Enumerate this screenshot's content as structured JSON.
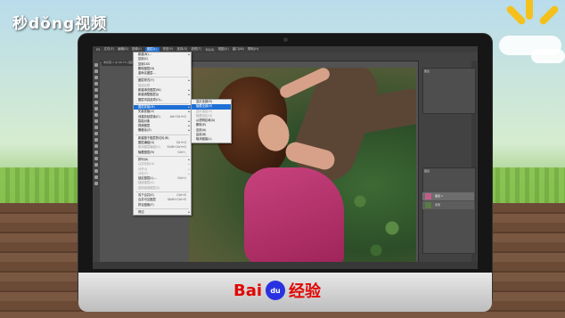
{
  "watermark_top": "秒dǒng视频",
  "brand": {
    "left": "Bai",
    "paw": "du",
    "right": "经验"
  },
  "menubar": [
    "PS",
    "文件(F)",
    "编辑(E)",
    "图像(I)",
    "图层(L)",
    "类型(Y)",
    "选择(S)",
    "滤镜(T)",
    "3D(D)",
    "视图(V)",
    "窗口(W)",
    "帮助(H)"
  ],
  "doc_tab": "未标题-1 @ 66.7% (图层 1, RGB/8)",
  "main_menu": {
    "items": [
      {
        "label": "新建(N)...",
        "shortcut": "",
        "disabled": false,
        "arrow": true
      },
      {
        "label": "复制(C)",
        "shortcut": "",
        "disabled": false
      },
      {
        "label": "复制CSS",
        "shortcut": "",
        "disabled": false
      },
      {
        "label": "删除图层(D)",
        "shortcut": "",
        "disabled": false
      },
      {
        "label": "重命名图层...",
        "shortcut": "",
        "disabled": false
      },
      {
        "label": "图层样式(Y)",
        "shortcut": "",
        "disabled": false,
        "arrow": true
      },
      {
        "label": "智能滤镜",
        "shortcut": "",
        "disabled": true
      },
      {
        "label": "新建填充图层(W)",
        "shortcut": "",
        "disabled": false,
        "arrow": true
      },
      {
        "label": "新建调整图层(J)",
        "shortcut": "",
        "disabled": false,
        "arrow": true
      },
      {
        "label": "图层内容选项(O)...",
        "shortcut": "",
        "disabled": false
      },
      {
        "label": "图层蒙版(M)",
        "shortcut": "",
        "disabled": false,
        "arrow": true,
        "highlight": true
      },
      {
        "label": "矢量蒙版(V)",
        "shortcut": "",
        "disabled": false,
        "arrow": true
      },
      {
        "label": "创建剪贴蒙版(C)",
        "shortcut": "Alt+Ctrl+G",
        "disabled": false
      },
      {
        "label": "智能对象",
        "shortcut": "",
        "disabled": false,
        "arrow": true
      },
      {
        "label": "视频图层",
        "shortcut": "",
        "disabled": false,
        "arrow": true
      },
      {
        "label": "栅格化(Z)",
        "shortcut": "",
        "disabled": false,
        "arrow": true
      },
      {
        "label": "新建基于图层的切片(B)",
        "shortcut": "",
        "disabled": false
      },
      {
        "label": "图层编组(G)",
        "shortcut": "Ctrl+G",
        "disabled": false
      },
      {
        "label": "取消图层编组(U)",
        "shortcut": "Shift+Ctrl+G",
        "disabled": true
      },
      {
        "label": "隐藏图层(R)",
        "shortcut": "Ctrl+,",
        "disabled": false
      },
      {
        "label": "排列(A)",
        "shortcut": "",
        "disabled": false,
        "arrow": true
      },
      {
        "label": "合并形状(H)",
        "shortcut": "",
        "disabled": true,
        "arrow": true
      },
      {
        "label": "对齐(I)",
        "shortcut": "",
        "disabled": true,
        "arrow": true
      },
      {
        "label": "分布(T)",
        "shortcut": "",
        "disabled": true,
        "arrow": true
      },
      {
        "label": "锁定图层(L)...",
        "shortcut": "Ctrl+/",
        "disabled": false
      },
      {
        "label": "链接图层(K)",
        "shortcut": "",
        "disabled": true
      },
      {
        "label": "选择链接图层(S)",
        "shortcut": "",
        "disabled": true
      },
      {
        "label": "向下合并(E)",
        "shortcut": "Ctrl+E",
        "disabled": false
      },
      {
        "label": "合并可见图层",
        "shortcut": "Shift+Ctrl+E",
        "disabled": false
      },
      {
        "label": "拼合图像(F)",
        "shortcut": "",
        "disabled": false
      },
      {
        "label": "修边",
        "shortcut": "",
        "disabled": false,
        "arrow": true
      }
    ]
  },
  "sub_menu": {
    "items": [
      {
        "label": "显示全部(R)",
        "disabled": false
      },
      {
        "label": "隐藏全部(H)",
        "disabled": false,
        "highlight": true
      },
      {
        "label": "显示选区(V)",
        "disabled": true
      },
      {
        "label": "隐藏选区(D)",
        "disabled": true
      },
      {
        "label": "从透明区域(A)",
        "disabled": false
      },
      {
        "label": "删除(E)",
        "disabled": false
      },
      {
        "label": "应用(A)",
        "disabled": false
      },
      {
        "label": "启用(B)",
        "disabled": false
      },
      {
        "label": "取消链接(L)",
        "disabled": false
      }
    ]
  },
  "panels": {
    "properties_label": "属性",
    "layers_label": "图层",
    "layer_name": "图层 1",
    "bg_layer_name": "背景"
  }
}
